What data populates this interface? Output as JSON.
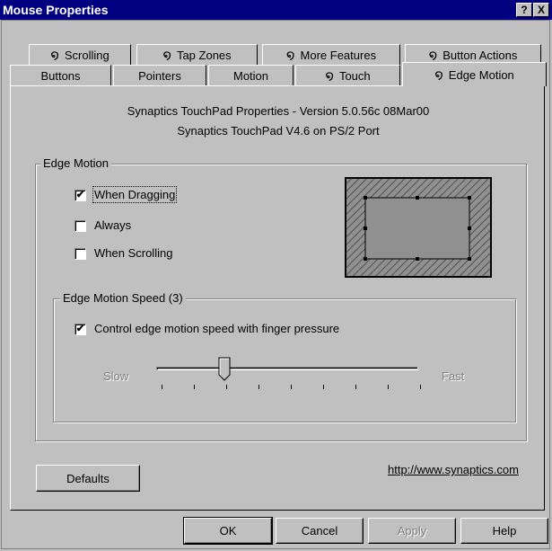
{
  "window": {
    "title": "Mouse Properties",
    "help_glyph": "?",
    "close_glyph": "X"
  },
  "tabs_back": [
    {
      "label": "Scrolling",
      "icon": "synaptics-swirl-icon"
    },
    {
      "label": "Tap Zones",
      "icon": "synaptics-swirl-icon"
    },
    {
      "label": "More Features",
      "icon": "synaptics-swirl-icon"
    },
    {
      "label": "Button Actions",
      "icon": "synaptics-swirl-icon"
    }
  ],
  "tabs_front": [
    {
      "label": "Buttons"
    },
    {
      "label": "Pointers"
    },
    {
      "label": "Motion"
    },
    {
      "label": "Touch",
      "icon": "synaptics-swirl-icon"
    },
    {
      "label": "Edge Motion",
      "icon": "synaptics-swirl-icon",
      "active": true
    }
  ],
  "header": {
    "line1": "Synaptics TouchPad Properties - Version 5.0.56c 08Mar00",
    "line2": "Synaptics TouchPad V4.6 on PS/2 Port"
  },
  "edge_motion": {
    "group_label": "Edge Motion",
    "options": [
      {
        "label": "When Dragging",
        "checked": true
      },
      {
        "label": "Always",
        "checked": false
      },
      {
        "label": "When Scrolling",
        "checked": false
      }
    ]
  },
  "speed": {
    "group_label": "Edge Motion Speed (3)",
    "pressure_label": "Control edge motion speed with finger pressure",
    "pressure_checked": true,
    "slow_label": "Slow",
    "fast_label": "Fast",
    "level": 3,
    "tick_count": 9
  },
  "footer": {
    "defaults_label": "Defaults",
    "link_text": "http://www.synaptics.com"
  },
  "buttons": {
    "ok": "OK",
    "cancel": "Cancel",
    "apply": "Apply",
    "help": "Help"
  },
  "check_glyph": "✔"
}
